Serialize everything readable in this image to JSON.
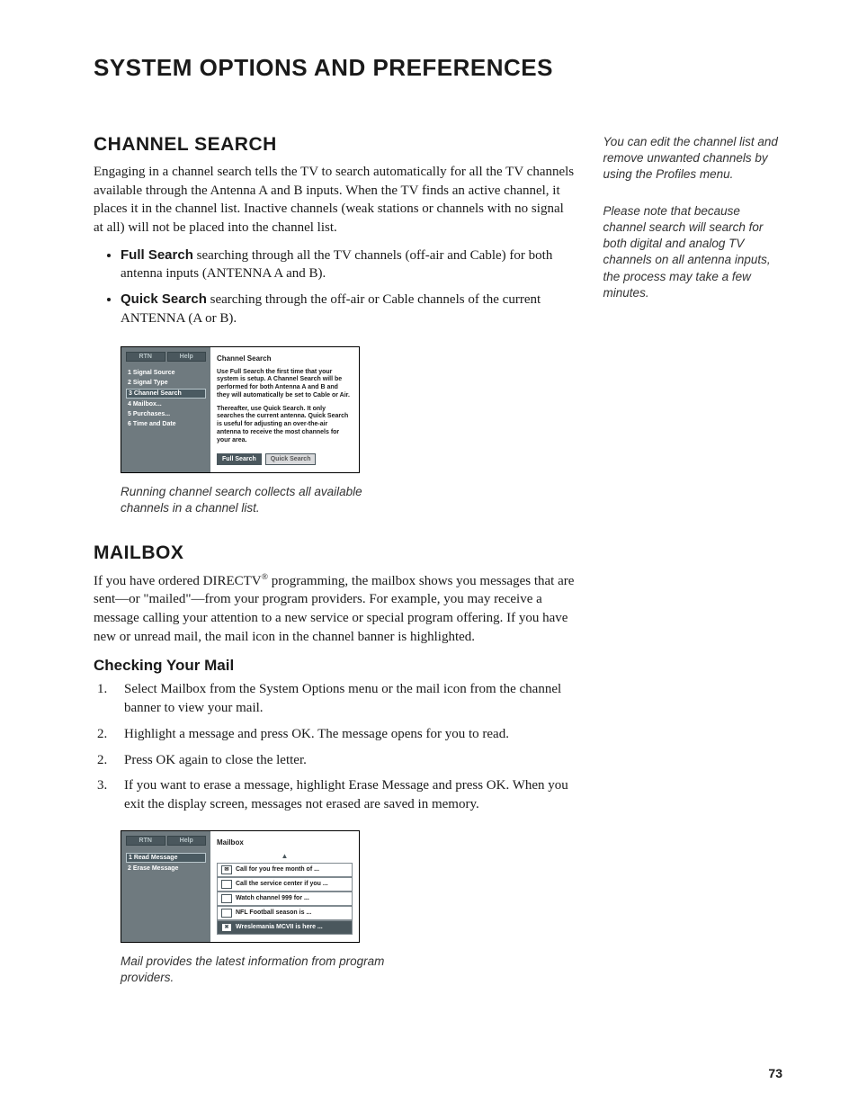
{
  "title": "SYSTEM OPTIONS AND PREFERENCES",
  "page_number": "73",
  "side_notes": [
    "You can edit the channel list and remove unwanted channels by using the Profiles menu.",
    "Please note that because channel search will search for both digital and analog TV channels on all antenna inputs, the process may take a few minutes."
  ],
  "channel_search": {
    "heading": "CHANNEL SEARCH",
    "intro": "Engaging in a channel search tells the TV to search automatically for all the TV channels available through the Antenna A and B inputs. When the TV finds an active channel, it places it in the channel list. Inactive channels (weak stations or channels with no signal at all) will not be placed into the channel list.",
    "bullets": [
      {
        "lead": "Full Search",
        "rest": "  searching through all the TV channels (off-air and Cable) for both antenna inputs (ANTENNA A and B)."
      },
      {
        "lead": "Quick Search",
        "rest": "  searching through the off-air or Cable channels of the current ANTENNA (A or B)."
      }
    ],
    "caption": "Running channel search collects all available channels in a channel list."
  },
  "cs_ui": {
    "tabs": [
      "RTN",
      "Help"
    ],
    "sidebar": [
      "1 Signal Source",
      "2 Signal Type",
      "3 Channel Search",
      "4 Mailbox...",
      "5 Purchases...",
      "6 Time and Date"
    ],
    "selected_index": 2,
    "panel_title": "Channel Search",
    "panel_body_1": "Use Full Search the first time that your system is setup. A Channel Search will be performed for both Antenna A and B and they will automatically be set to Cable or Air.",
    "panel_body_2": "Thereafter, use Quick Search. It only searches the current antenna. Quick Search is useful for adjusting an over-the-air antenna to receive the most channels for your area.",
    "btn_primary": "Full Search",
    "btn_secondary": "Quick Search"
  },
  "mailbox": {
    "heading": "MAILBOX",
    "intro_pre": "If you have ordered DIRECTV",
    "intro_post": " programming, the mailbox shows you messages that are sent—or \"mailed\"—from your program providers. For example, you may receive a message calling your attention to a new service or special program offering. If you have new or unread mail, the mail icon in the channel banner is highlighted.",
    "sub": "Checking Your Mail",
    "steps": [
      {
        "num": "1.",
        "text": "Select Mailbox from the System Options menu or the mail icon from the channel banner to view your mail."
      },
      {
        "num": "2.",
        "text": "Highlight a message and press OK. The message opens for you to read."
      },
      {
        "num": "2.",
        "text": "Press OK again to close the letter."
      },
      {
        "num": "3.",
        "text": "If you want to erase a message, highlight Erase Message and press OK. When you exit the display screen, messages not erased are saved in memory."
      }
    ],
    "caption": "Mail provides the latest information from program providers."
  },
  "mb_ui": {
    "tabs": [
      "RTN",
      "Help"
    ],
    "sidebar": [
      "1 Read Message",
      "2 Erase Message"
    ],
    "selected_index": 0,
    "panel_title": "Mailbox",
    "rows": [
      {
        "icon": "✉",
        "label": "Call for you free month of ...",
        "active": false
      },
      {
        "icon": "",
        "label": "Call the service center if you ...",
        "active": false
      },
      {
        "icon": "",
        "label": "Watch channel 999 for ...",
        "active": false
      },
      {
        "icon": "",
        "label": "NFL Football season is ...",
        "active": false
      },
      {
        "icon": "✖",
        "label": "Wreslemania MCVII is here ...",
        "active": true
      }
    ]
  }
}
